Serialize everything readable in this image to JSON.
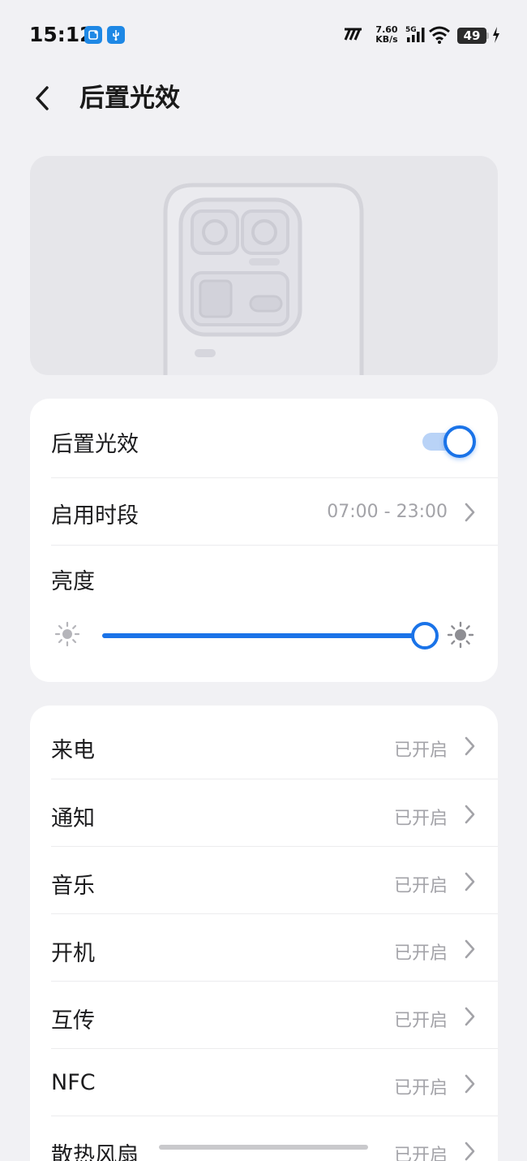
{
  "status_bar": {
    "time": "15:12",
    "net_speed_value": "7.60",
    "net_speed_unit": "KB/s",
    "network_type": "5G",
    "battery": "49"
  },
  "header": {
    "title": "后置光效"
  },
  "settings": {
    "light_effect": {
      "label": "后置光效",
      "enabled": true
    },
    "schedule": {
      "label": "启用时段",
      "value": "07:00 - 23:00"
    },
    "brightness": {
      "label": "亮度",
      "level_percent": 100
    }
  },
  "triggers": [
    {
      "label": "来电",
      "status": "已开启"
    },
    {
      "label": "通知",
      "status": "已开启"
    },
    {
      "label": "音乐",
      "status": "已开启"
    },
    {
      "label": "开机",
      "status": "已开启"
    },
    {
      "label": "互传",
      "status": "已开启"
    },
    {
      "label": "NFC",
      "status": "已开启"
    },
    {
      "label": "散热风扇",
      "status": "已开启"
    }
  ],
  "colors": {
    "accent": "#1a73e8",
    "background": "#f1f1f4",
    "card": "#ffffff",
    "secondary_text": "#a3a3a8"
  }
}
